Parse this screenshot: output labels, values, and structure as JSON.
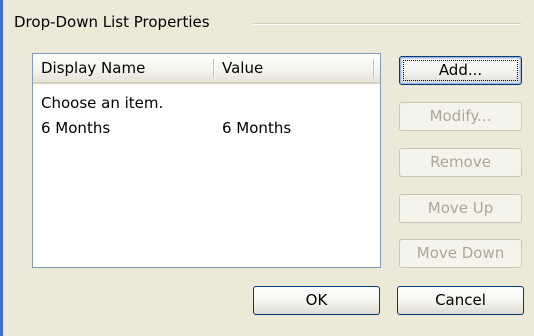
{
  "group": {
    "title": "Drop-Down List Properties"
  },
  "list": {
    "columns": [
      "Display Name",
      "Value"
    ],
    "rows": [
      {
        "name": "Choose an item.",
        "value": ""
      },
      {
        "name": "6 Months",
        "value": "6 Months"
      }
    ]
  },
  "buttons": {
    "add": "Add...",
    "modify": "Modify...",
    "remove": "Remove",
    "move_up": "Move Up",
    "move_down": "Move Down",
    "ok": "OK",
    "cancel": "Cancel"
  },
  "colors": {
    "window_background": "#ece9d8",
    "button_border": "#003c74",
    "disabled_text": "#aca899",
    "list_border": "#7f9db9"
  }
}
